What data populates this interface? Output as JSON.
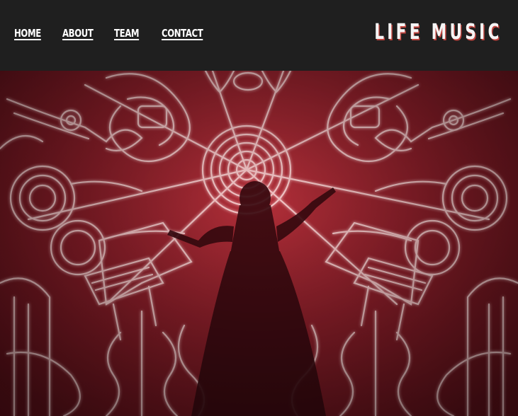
{
  "nav": {
    "items": [
      {
        "label": "HOME"
      },
      {
        "label": "ABOUT"
      },
      {
        "label": "TEAM"
      },
      {
        "label": "CONTACT"
      }
    ]
  },
  "brand": {
    "logo_text": "LIFE MUSIC"
  },
  "hero": {
    "image": "neon-orchestra-conductor",
    "colors": {
      "neon": "#ffd6d6",
      "glow": "#ff5a64",
      "base": "#8e1f2a",
      "silhouette": "#3a0a10"
    }
  }
}
